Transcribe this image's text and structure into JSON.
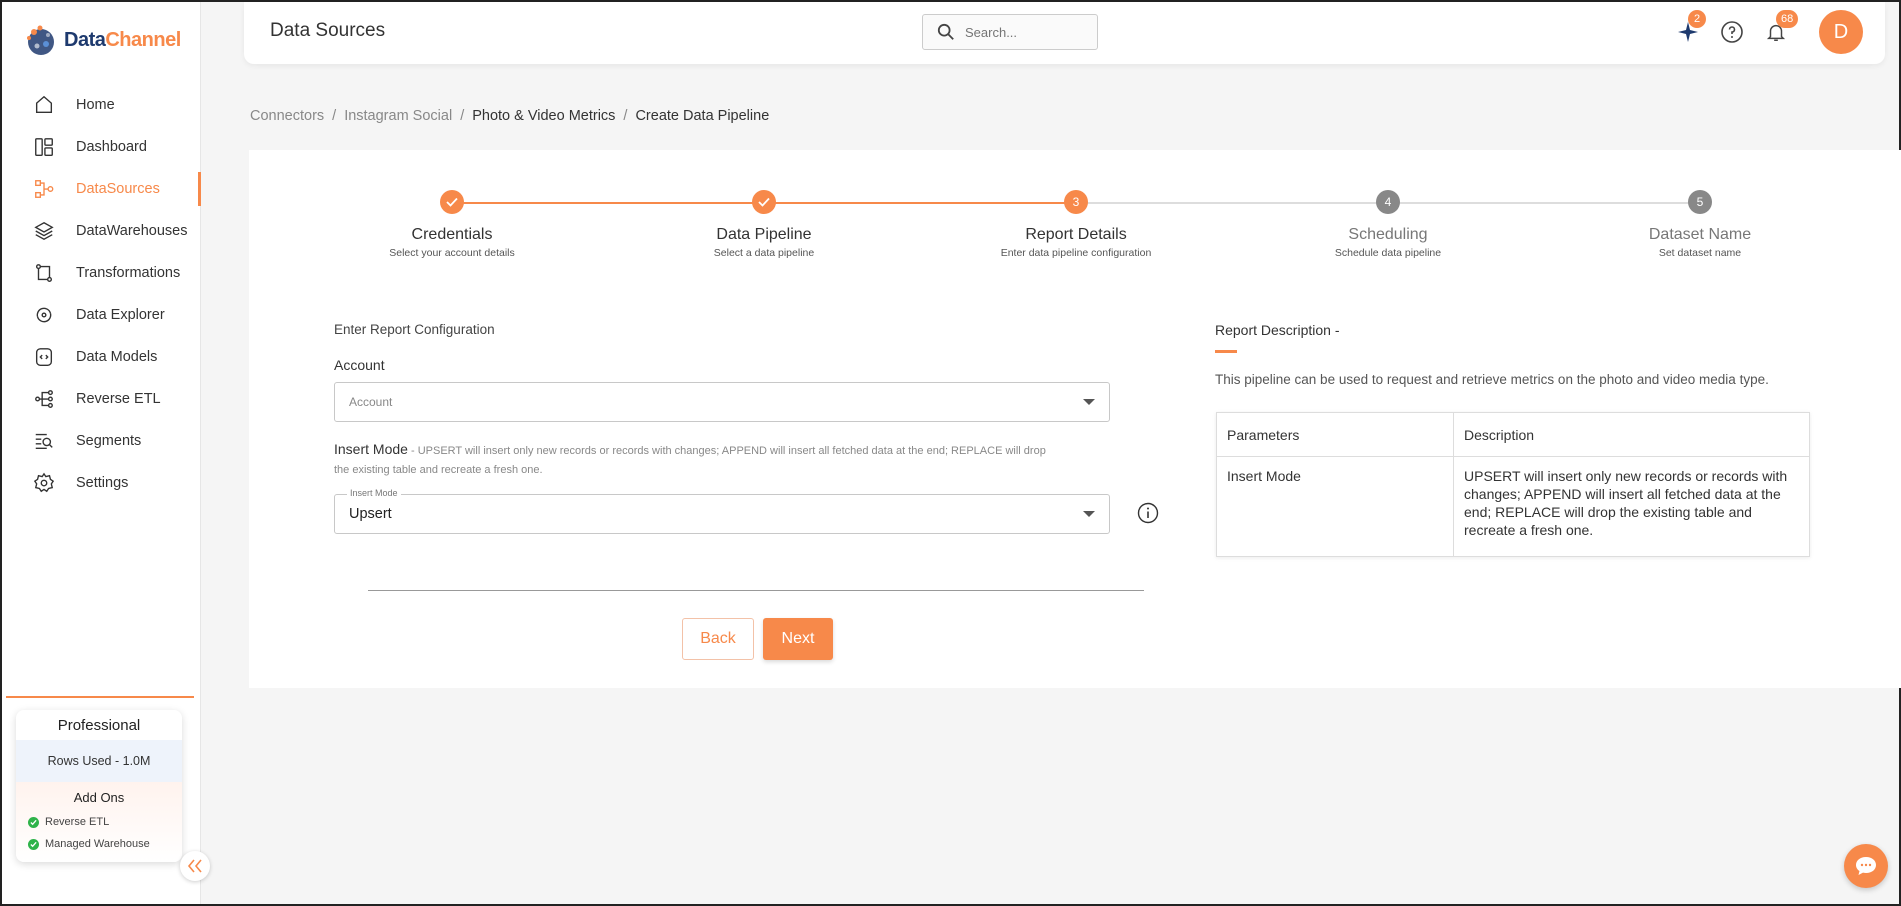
{
  "app": {
    "logo_part1": "Data",
    "logo_part2": "Channel"
  },
  "sidebar": {
    "items": [
      {
        "label": "Home",
        "icon": "home-icon"
      },
      {
        "label": "Dashboard",
        "icon": "dashboard-icon"
      },
      {
        "label": "DataSources",
        "icon": "datasources-icon",
        "active": true
      },
      {
        "label": "DataWarehouses",
        "icon": "layers-icon"
      },
      {
        "label": "Transformations",
        "icon": "transform-icon"
      },
      {
        "label": "Data Explorer",
        "icon": "explorer-icon"
      },
      {
        "label": "Data Models",
        "icon": "models-icon"
      },
      {
        "label": "Reverse ETL",
        "icon": "share-icon"
      },
      {
        "label": "Segments",
        "icon": "segments-icon"
      },
      {
        "label": "Settings",
        "icon": "gear-icon"
      }
    ],
    "plan": {
      "title": "Professional",
      "rows_used": "Rows Used - 1.0M",
      "addons_title": "Add Ons",
      "addons": [
        "Reverse ETL",
        "Managed Warehouse"
      ]
    }
  },
  "header": {
    "title": "Data Sources",
    "search_placeholder": "Search...",
    "sparkle_badge": "2",
    "notification_badge": "68",
    "avatar_initial": "D"
  },
  "breadcrumb": {
    "items": [
      "Connectors",
      "Instagram Social",
      "Photo & Video Metrics",
      "Create Data Pipeline"
    ]
  },
  "stepper": {
    "steps": [
      {
        "marker": "",
        "title": "Credentials",
        "subtitle": "Select your account details",
        "state": "done"
      },
      {
        "marker": "",
        "title": "Data Pipeline",
        "subtitle": "Select a data pipeline",
        "state": "done"
      },
      {
        "marker": "3",
        "title": "Report Details",
        "subtitle": "Enter data pipeline configuration",
        "state": "current"
      },
      {
        "marker": "4",
        "title": "Scheduling",
        "subtitle": "Schedule data pipeline",
        "state": "todo"
      },
      {
        "marker": "5",
        "title": "Dataset Name",
        "subtitle": "Set dataset name",
        "state": "todo"
      }
    ]
  },
  "form": {
    "heading": "Enter Report Configuration",
    "account_label": "Account",
    "account_placeholder": "Account",
    "insert_mode_label": "Insert Mode",
    "insert_mode_hint": " - UPSERT will insert only new records or records with changes; APPEND will insert all fetched data at the end; REPLACE will drop the existing table and recreate a fresh one.",
    "insert_mode_floating": "Insert Mode",
    "insert_mode_value": "Upsert",
    "back_label": "Back",
    "next_label": "Next"
  },
  "description": {
    "title": "Report Description -",
    "text": "This pipeline can be used to request and retrieve metrics on the photo and video media type.",
    "table_headers": [
      "Parameters",
      "Description"
    ],
    "table_rows": [
      [
        "Insert Mode",
        "UPSERT will insert only new records or records with changes; APPEND will insert all fetched data at the end; REPLACE will drop the existing table and recreate a fresh one."
      ]
    ]
  },
  "colors": {
    "accent": "#f7894a",
    "brand_dark": "#1e3a6e",
    "success": "#2fb34a"
  }
}
